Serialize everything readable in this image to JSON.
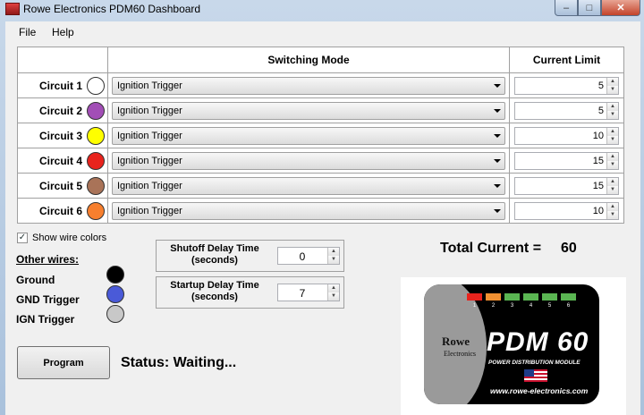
{
  "window": {
    "title": "Rowe Electronics PDM60 Dashboard"
  },
  "menu": {
    "file": "File",
    "help": "Help"
  },
  "grid": {
    "headers": {
      "switching_mode": "Switching Mode",
      "current_limit": "Current Limit"
    },
    "circuits": [
      {
        "label": "Circuit 1",
        "color": "#ffffff",
        "mode": "Ignition Trigger",
        "limit": "5"
      },
      {
        "label": "Circuit 2",
        "color": "#a24eb6",
        "mode": "Ignition Trigger",
        "limit": "5"
      },
      {
        "label": "Circuit 3",
        "color": "#ffff00",
        "mode": "Ignition Trigger",
        "limit": "10"
      },
      {
        "label": "Circuit 4",
        "color": "#e8231d",
        "mode": "Ignition Trigger",
        "limit": "15"
      },
      {
        "label": "Circuit 5",
        "color": "#a97358",
        "mode": "Ignition Trigger",
        "limit": "15"
      },
      {
        "label": "Circuit 6",
        "color": "#f77f2e",
        "mode": "Ignition Trigger",
        "limit": "10"
      }
    ]
  },
  "show_wire_colors": {
    "label": "Show wire colors",
    "checked": true
  },
  "other_wires": {
    "title": "Other wires:",
    "items": [
      {
        "label": "Ground",
        "color": "#000000"
      },
      {
        "label": "GND Trigger",
        "color": "#4a5ad8"
      },
      {
        "label": "IGN Trigger",
        "color": "#c8c8c8"
      }
    ]
  },
  "shutoff_delay": {
    "label_line1": "Shutoff Delay Time",
    "label_line2": "(seconds)",
    "value": "0"
  },
  "startup_delay": {
    "label_line1": "Startup Delay Time",
    "label_line2": "(seconds)",
    "value": "7"
  },
  "total_current": {
    "label": "Total Current =",
    "value": "60"
  },
  "logo": {
    "brand": "Rowe",
    "brand_sub": "Electronics",
    "product": "PDM 60",
    "subtitle": "POWER DISTRIBUTION MODULE",
    "url": "www.rowe-electronics.com",
    "led_numbers": [
      "1",
      "2",
      "3",
      "4",
      "5",
      "6"
    ],
    "led_colors": [
      "#e8231d",
      "#f29132",
      "#5ab552",
      "#5ab552",
      "#5ab552",
      "#5ab552"
    ]
  },
  "program_button": "Program",
  "status": "Status: Waiting..."
}
